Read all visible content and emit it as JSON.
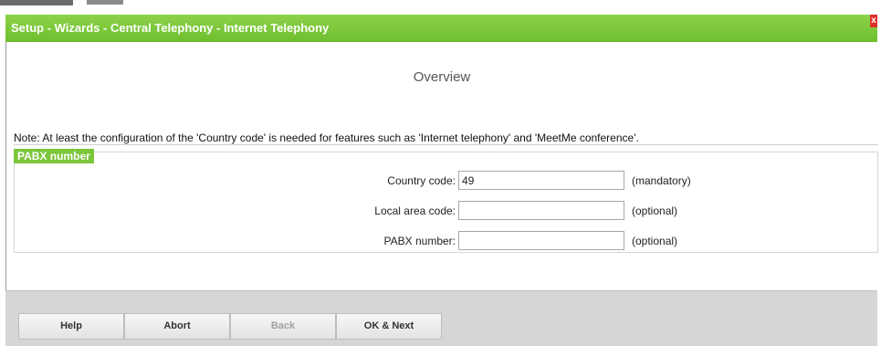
{
  "window": {
    "title": "Setup - Wizards - Central Telephony - Internet Telephony",
    "close_label": "x"
  },
  "page": {
    "heading": "Overview"
  },
  "note": "Note: At least the configuration of the 'Country code' is needed for features such as 'Internet telephony' and 'MeetMe conference'.",
  "pabx_section": {
    "legend": "PABX number",
    "fields": [
      {
        "label": "Country code:",
        "value": "49",
        "hint": "(mandatory)"
      },
      {
        "label": "Local area code:",
        "value": "",
        "hint": "(optional)"
      },
      {
        "label": "PABX number:",
        "value": "",
        "hint": "(optional)"
      }
    ]
  },
  "footer": {
    "help_label": "Help",
    "abort_label": "Abort",
    "back_label": "Back",
    "ok_next_label": "OK & Next"
  }
}
